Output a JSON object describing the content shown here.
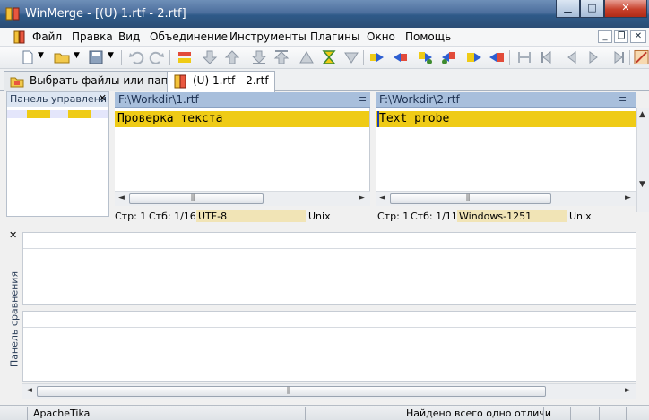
{
  "window": {
    "title": "WinMerge - [(U) 1.rtf - 2.rtf]"
  },
  "menu": [
    "Файл",
    "Правка",
    "Вид",
    "Объединение",
    "Инструменты",
    "Плагины",
    "Окно",
    "Помощь"
  ],
  "tabs": [
    {
      "label": "Выбрать файлы или папки"
    },
    {
      "label": "(U) 1.rtf - 2.rtf"
    }
  ],
  "location_pane": {
    "title": "Панель управлени"
  },
  "left_file": {
    "path": "F:\\Workdir\\1.rtf",
    "line": "Проверка текста",
    "status": {
      "line": "Стр: 1",
      "col": "Стб: 1/16",
      "encoding": "UTF-8",
      "eol": "Unix"
    }
  },
  "right_file": {
    "path": "F:\\Workdir\\2.rtf",
    "line": "Text probe",
    "status": {
      "line": "Стр: 1",
      "col": "Стб: 1/11",
      "encoding": "Windows-1251",
      "eol": "Unix"
    }
  },
  "compare_panel": {
    "title": "Панель сравнения"
  },
  "statusbar": {
    "left": "ApacheTika",
    "right": "Найдено всего одно отличи"
  },
  "icons": {
    "pane_menu": "≡",
    "close": "×",
    "minimize": "▁",
    "maximize": "□",
    "scroll_left": "◄",
    "scroll_right": "►",
    "scroll_up": "▲",
    "scroll_down": "▼",
    "grip": "⫼"
  },
  "colors": {
    "diff_yellow": "#efcb16",
    "encoding_bg": "#f1e4b6",
    "pane_header": "#a8bfdc"
  }
}
